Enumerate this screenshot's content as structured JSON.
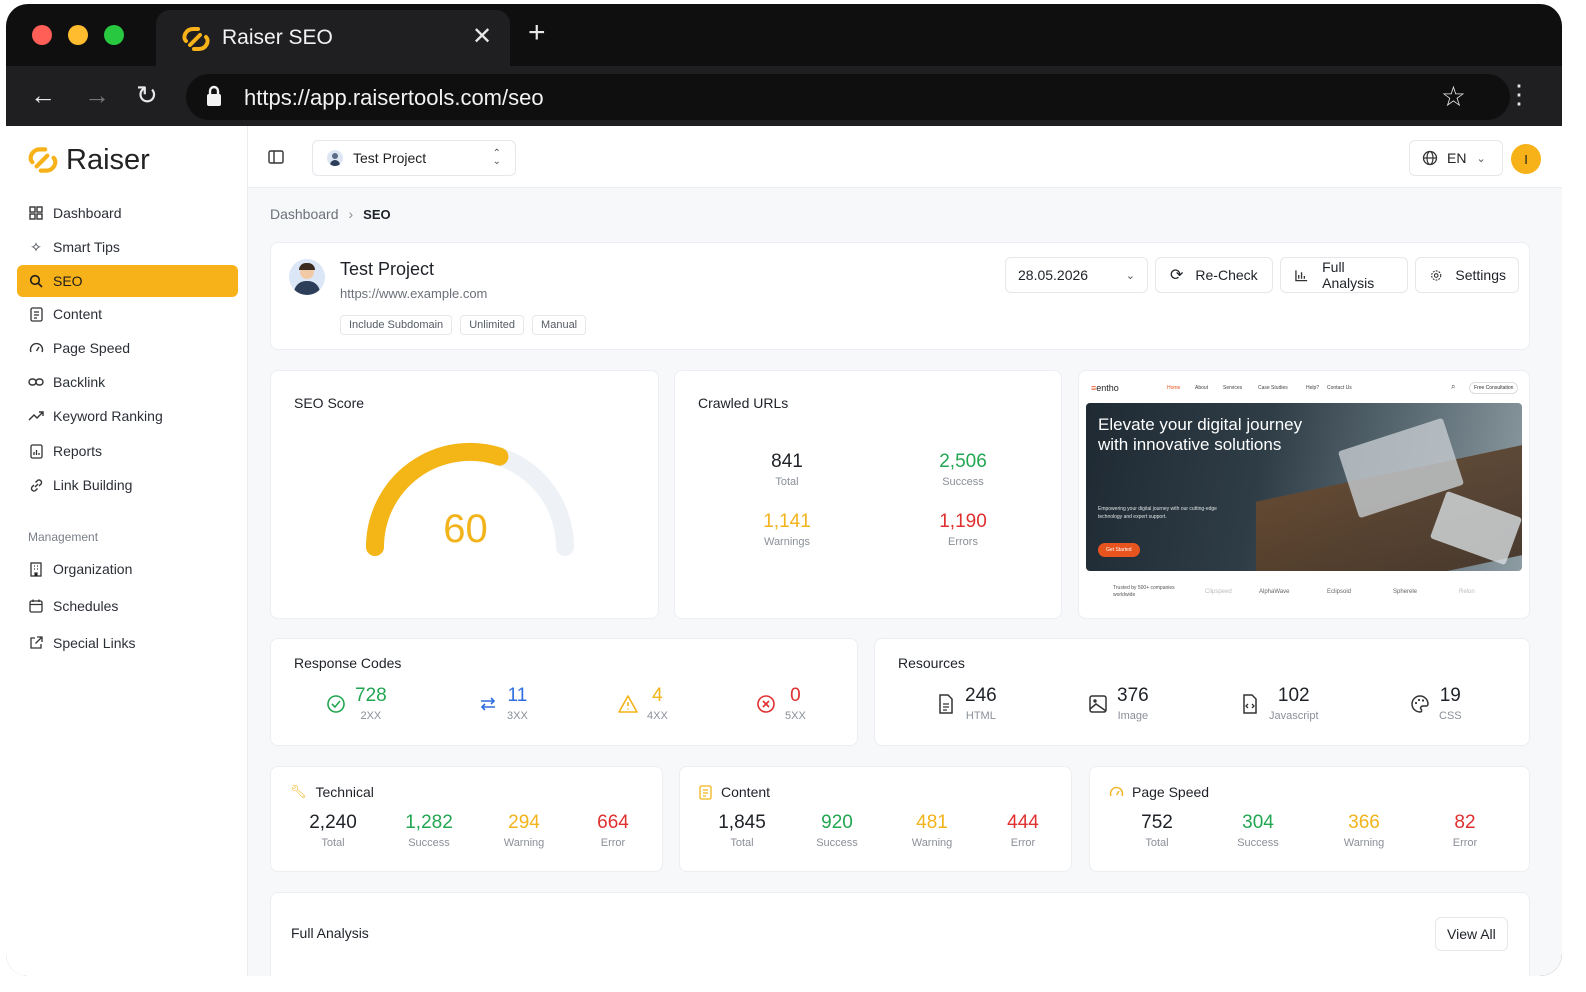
{
  "browser": {
    "tab_title": "Raiser SEO",
    "url": "https://app.raisertools.com/seo"
  },
  "brand": {
    "name": "Raiser",
    "color": "#f7b21a"
  },
  "sidebar": {
    "items": [
      {
        "label": "Dashboard",
        "icon": "grid-icon"
      },
      {
        "label": "Smart Tips",
        "icon": "sparkle-icon"
      },
      {
        "label": "SEO",
        "icon": "search-icon",
        "active": true
      },
      {
        "label": "Content",
        "icon": "document-icon"
      },
      {
        "label": "Page Speed",
        "icon": "gauge-icon"
      },
      {
        "label": "Backlink",
        "icon": "link-icon"
      },
      {
        "label": "Keyword Ranking",
        "icon": "trend-icon"
      },
      {
        "label": "Reports",
        "icon": "report-icon"
      },
      {
        "label": "Link Building",
        "icon": "chain-icon"
      }
    ],
    "management_label": "Management",
    "management_items": [
      {
        "label": "Organization",
        "icon": "building-icon"
      },
      {
        "label": "Schedules",
        "icon": "calendar-icon"
      },
      {
        "label": "Special Links",
        "icon": "external-link-icon"
      }
    ]
  },
  "topbar": {
    "project": "Test Project",
    "language": "EN",
    "avatar_initial": "I"
  },
  "breadcrumb": {
    "parent": "Dashboard",
    "current": "SEO"
  },
  "project": {
    "name": "Test Project",
    "url": "https://www.example.com",
    "tags": [
      "Include Subdomain",
      "Unlimited",
      "Manual"
    ],
    "date": "28.05.2026",
    "recheck_label": "Re-Check",
    "full_analysis_label": "Full Analysis",
    "settings_label": "Settings"
  },
  "seo_score": {
    "title": "SEO Score",
    "value": "60",
    "fraction": 0.6
  },
  "crawled": {
    "title": "Crawled URLs",
    "total": {
      "value": "841",
      "label": "Total"
    },
    "success": {
      "value": "2,506",
      "label": "Success"
    },
    "warnings": {
      "value": "1,141",
      "label": "Warnings"
    },
    "errors": {
      "value": "1,190",
      "label": "Errors"
    }
  },
  "preview": {
    "logo": "entho",
    "nav": [
      "Home",
      "About",
      "Services",
      "Case Studies",
      "Help?",
      "Contact Us"
    ],
    "cta_top": "Free Consultation",
    "headline_1": "Elevate your digital journey",
    "headline_2": "with innovative solutions",
    "sub": "Empowering your digital journey with our cutting-edge technology and expert support.",
    "cta": "Get Started",
    "trusted": "Trusted by 500+ companies worldwide",
    "logos": [
      "Clipspeed",
      "AlphaWave",
      "Eclipsoid",
      "Spherele",
      "Relon"
    ]
  },
  "response_codes": {
    "title": "Response Codes",
    "items": [
      {
        "value": "728",
        "label": "2XX"
      },
      {
        "value": "11",
        "label": "3XX"
      },
      {
        "value": "4",
        "label": "4XX"
      },
      {
        "value": "0",
        "label": "5XX"
      }
    ]
  },
  "resources": {
    "title": "Resources",
    "items": [
      {
        "value": "246",
        "label": "HTML"
      },
      {
        "value": "376",
        "label": "Image"
      },
      {
        "value": "102",
        "label": "Javascript"
      },
      {
        "value": "19",
        "label": "CSS"
      }
    ]
  },
  "technical": {
    "title": "Technical",
    "total": "2,240",
    "success": "1,282",
    "warning": "294",
    "error": "664"
  },
  "content": {
    "title": "Content",
    "total": "1,845",
    "success": "920",
    "warning": "481",
    "error": "444"
  },
  "page_speed": {
    "title": "Page Speed",
    "total": "752",
    "success": "304",
    "warning": "366",
    "error": "82"
  },
  "labels": {
    "total": "Total",
    "success": "Success",
    "warning": "Warning",
    "error": "Error"
  },
  "full_analysis": {
    "title": "Full Analysis",
    "view_all": "View All"
  }
}
